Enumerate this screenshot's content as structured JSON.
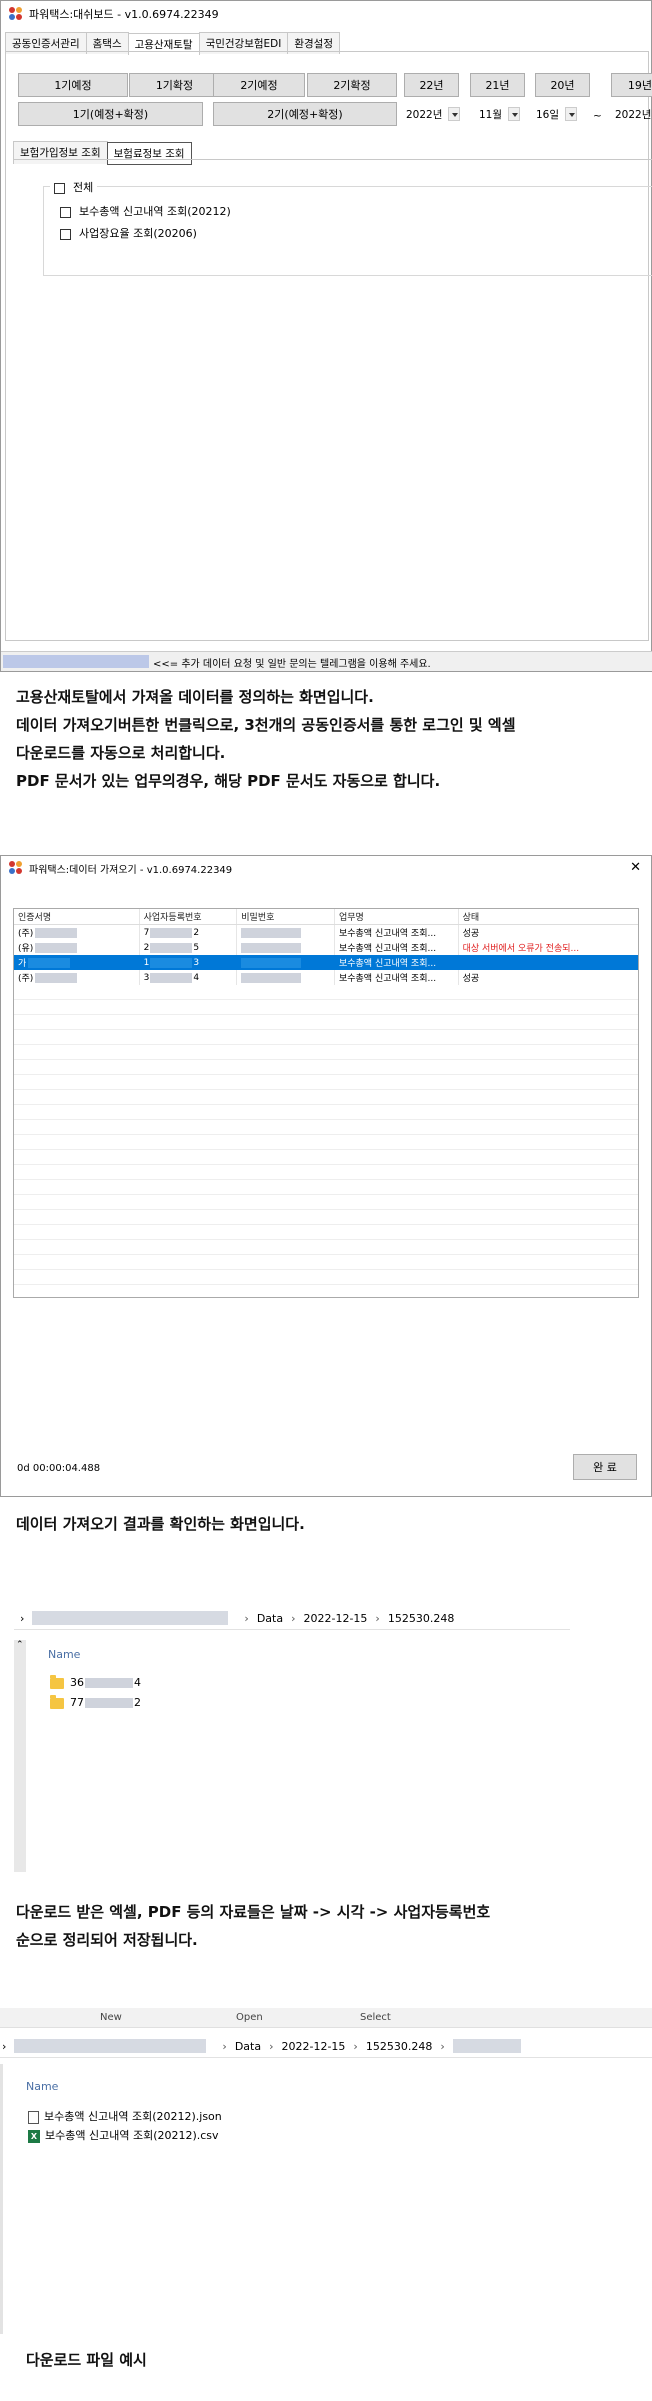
{
  "dashboard": {
    "title": "파워택스:대쉬보드 - v1.0.6974.22349",
    "tabs": [
      "공동인증서관리",
      "홈택스",
      "고용산재토탈",
      "국민건강보험EDI",
      "환경설정"
    ],
    "buttons_row1": [
      "1기예정",
      "1기확정",
      "2기예정",
      "2기확정",
      "22년",
      "21년",
      "20년",
      "19년"
    ],
    "buttons_row2": [
      "1기(예정+확정)",
      "2기(예정+확정)"
    ],
    "date": {
      "year": "2022년",
      "month": "11월",
      "day": "16일",
      "tilde": "~",
      "year2": "2022년"
    },
    "subtabs": [
      "보험가입정보 조회",
      "보험료정보 조회"
    ],
    "checks": {
      "all": "전체",
      "item1": "보수총액 신고내역 조회(20212)",
      "item2": "사업장요율 조회(20206)"
    },
    "status_text": "<<= 추가 데이터 요청 및 일반 문의는 텔레그램을 이용해 주세요."
  },
  "captions": {
    "c1": [
      "고용산재토탈에서 가져올 데이터를 정의하는 화면입니다.",
      "데이터 가져오기버튼한 번클릭으로, 3천개의 공동인증서를 통한 로그인 및 엑셀",
      "다운로드를 자동으로 처리합니다.",
      "PDF 문서가 있는 업무의경우, 해당 PDF 문서도 자동으로 합니다."
    ],
    "c2": "데이터 가져오기 결과를 확인하는 화면입니다.",
    "c3": [
      "다운로드 받은 엑셀, PDF 등의 자료들은 날짜 -> 시각 -> 사업자등록번호",
      "순으로 정리되어 저장됩니다."
    ],
    "c4": "다운로드 파일 예시"
  },
  "import_window": {
    "title": "파워택스:데이터 가져오기 - v1.0.6974.22349",
    "close": "✕",
    "columns": [
      "인증서명",
      "사업자등록번호",
      "비밀번호",
      "업무명",
      "상태"
    ],
    "rows": [
      {
        "name": "(주)",
        "bizno_a": "7",
        "bizno_b": "2",
        "task": "보수총액 신고내역 조회...",
        "status": "성공"
      },
      {
        "name": "(유)",
        "bizno_a": "2",
        "bizno_b": "5",
        "task": "보수총액 신고내역 조회...",
        "status": "대상 서버에서 오류가 전송되..."
      },
      {
        "name": "가",
        "bizno_a": "1",
        "bizno_b": "3",
        "task": "보수총액 신고내역 조회...",
        "status": ""
      },
      {
        "name": "(주)",
        "bizno_a": "3",
        "bizno_b": "4",
        "task": "보수총액 신고내역 조회...",
        "status": "성공"
      }
    ],
    "elapsed": "0d 00:00:04.488",
    "done_button": "완 료"
  },
  "explorer1": {
    "path": [
      "Data",
      "2022-12-15",
      "152530.248"
    ],
    "header": "Name",
    "folders": [
      {
        "a": "36",
        "b": "4"
      },
      {
        "a": "77",
        "b": "2"
      }
    ]
  },
  "explorer2": {
    "ribbon": [
      "New",
      "Open",
      "Select"
    ],
    "path": [
      "Data",
      "2022-12-15",
      "152530.248"
    ],
    "header": "Name",
    "files": [
      "보수총액 신고내역 조회(20212).json",
      "보수총액 신고내역 조회(20212).csv"
    ],
    "csv_badge": "X"
  },
  "colors": {
    "selected_row": "#0078d7",
    "error_text": "#e02020",
    "status_bar_blue": "#bcc8e8"
  }
}
